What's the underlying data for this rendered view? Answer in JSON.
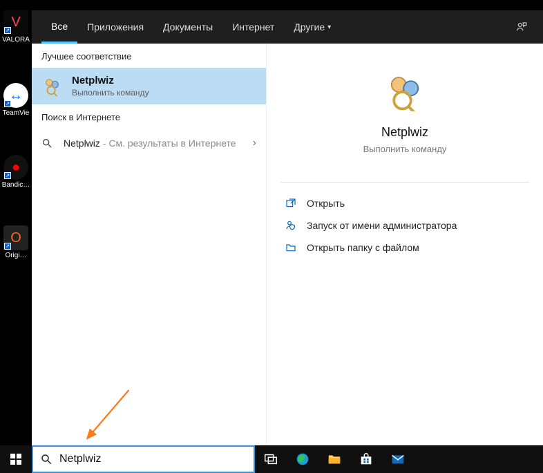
{
  "desktop": {
    "icons": [
      {
        "name": "VALORA",
        "glyph": "V"
      },
      {
        "name": "TeamVie",
        "glyph": "●"
      },
      {
        "name": "Bandic…",
        "glyph": "●"
      },
      {
        "name": "Origi…",
        "glyph": "O"
      }
    ]
  },
  "tabs": {
    "items": [
      "Все",
      "Приложения",
      "Документы",
      "Интернет",
      "Другие"
    ],
    "active_index": 0
  },
  "results": {
    "best_match_header": "Лучшее соответствие",
    "top": {
      "title": "Netplwiz",
      "subtitle": "Выполнить команду"
    },
    "web_header": "Поиск в Интернете",
    "web": {
      "query": "Netplwiz",
      "suffix": " - См. результаты в Интернете"
    }
  },
  "preview": {
    "title": "Netplwiz",
    "subtitle": "Выполнить команду",
    "actions": [
      "Открыть",
      "Запуск от имени администратора",
      "Открыть папку с файлом"
    ]
  },
  "searchbox": {
    "value": "Netplwiz",
    "placeholder": ""
  }
}
